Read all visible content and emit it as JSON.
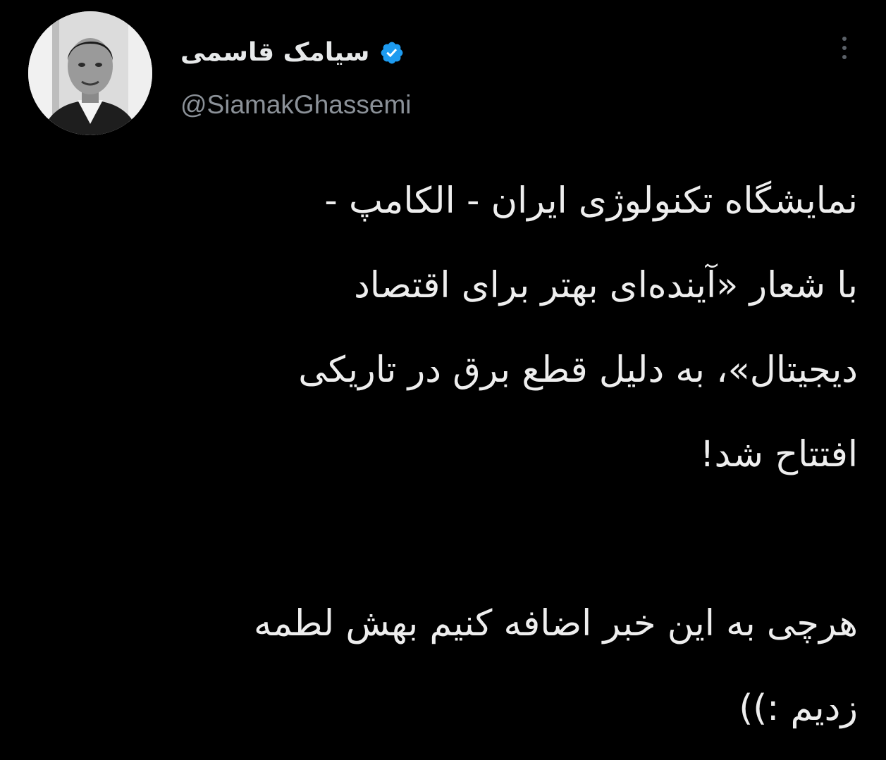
{
  "user": {
    "display_name": "سیامک قاسمی",
    "handle": "@SiamakGhassemi",
    "verified": true,
    "verified_icon": "verified-badge-icon",
    "verified_color": "#1d9bf0"
  },
  "tweet": {
    "lines": [
      "نمایشگاه تکنولوژی ایران - الکامپ -",
      "با شعار «آینده‌ای بهتر برای اقتصاد",
      "دیجیتال»، به دلیل قطع برق در تاریکی",
      "افتتاح شد!",
      "",
      "هرچی به این خبر اضافه کنیم بهش لطمه",
      "زدیم :))"
    ]
  },
  "menu": {
    "icon": "more-vertical-icon"
  },
  "colors": {
    "background": "#000000",
    "text": "#e7e9ea",
    "secondary_text": "#8b9198"
  }
}
